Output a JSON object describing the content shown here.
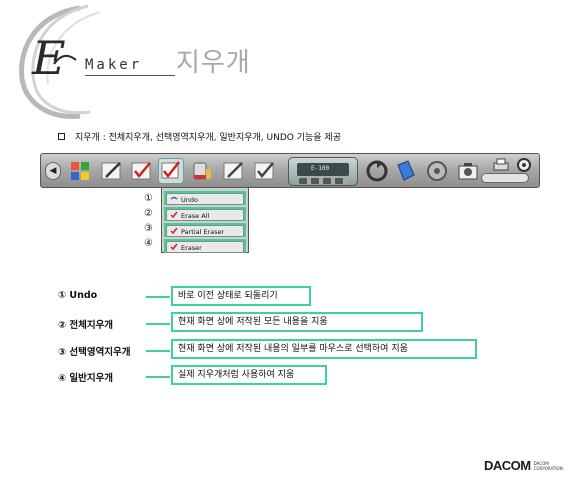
{
  "header": {
    "maker_word": "Maker",
    "title": "지우개"
  },
  "description": {
    "text": "지우개 : 전체지우개, 선택영역지우개, 일반지우개, UNDO 기능을 제공"
  },
  "toolbar": {
    "screen_label": "E-100",
    "icons": [
      "arrow-left-icon",
      "windows-icon",
      "pen-icon",
      "check-pen-icon",
      "eraser-icon",
      "paint-bucket-icon",
      "pen-icon",
      "check-pen-icon",
      "screen-panel",
      "refresh-icon",
      "book-icon",
      "wheel-icon",
      "camera-icon",
      "printer-icon",
      "target-icon"
    ]
  },
  "dropdown": {
    "items": [
      {
        "num": "①",
        "label": "Undo"
      },
      {
        "num": "②",
        "label": "Erase All"
      },
      {
        "num": "③",
        "label": "Partial Eraser"
      },
      {
        "num": "④",
        "label": "Eraser"
      }
    ]
  },
  "legend": [
    {
      "label": "① Undo",
      "desc": "바로 이전 상태로 되돌리기"
    },
    {
      "label": "② 전체지우개",
      "desc": "현재 화면 상에 저작된 모든 내용을 지움"
    },
    {
      "label": "③ 선택영역지우개",
      "desc": "현재 화면 상에 저작된 내용의 일부를 마우스로 선택하여 지움"
    },
    {
      "label": "④ 일반지우개",
      "desc": "실제 지우개처럼 사용하여 지움"
    }
  ],
  "company": {
    "name": "DACOM",
    "sub": "DACOM CORPORATION"
  }
}
